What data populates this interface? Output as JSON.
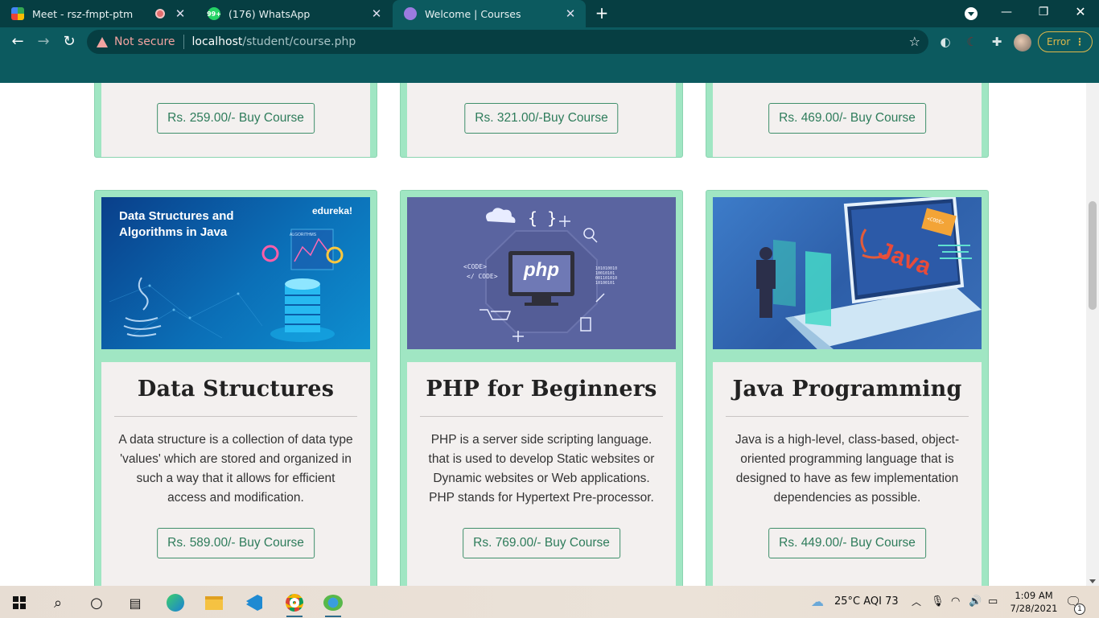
{
  "browser": {
    "tabs": [
      {
        "title": "Meet - rsz-fmpt-ptm",
        "active": false,
        "favicon": "google-meet-icon",
        "recording": true
      },
      {
        "title": "(176) WhatsApp",
        "active": false,
        "favicon": "whatsapp-icon",
        "badge": "99+"
      },
      {
        "title": "Welcome | Courses",
        "active": true,
        "favicon": "courses-site-icon"
      }
    ],
    "address_bar": {
      "security_label": "Not secure",
      "url_host": "localhost",
      "url_path": "/student/course.php"
    },
    "error_label": "Error",
    "accent": "#0c5a5f"
  },
  "courses_top_row": [
    {
      "button_label": "Rs. 259.00/- Buy Course"
    },
    {
      "button_label": "Rs. 321.00/-Buy Course"
    },
    {
      "button_label": "Rs. 469.00/- Buy Course"
    }
  ],
  "courses": [
    {
      "title": "Data Structures",
      "description": "A data structure is a collection of data type 'values' which are stored and organized in such a way that it allows for efficient access and modification.",
      "button_label": "Rs. 589.00/- Buy Course",
      "image": {
        "heading": "Data Structures and Algorithms in Java",
        "brand": "edureka!",
        "label": "ALGORITHMS"
      }
    },
    {
      "title": "PHP for Beginners",
      "description": "PHP is a server side scripting language. that is used to develop Static websites or Dynamic websites or Web applications. PHP stands for Hypertext Pre-processor.",
      "button_label": "Rs. 769.00/- Buy Course",
      "image": {
        "logo_text": "php",
        "code1": "<CODE>",
        "code2": "</ CODE>",
        "braces": "{ }",
        "binary": "101010010\n10010101\n001101010\n10100101"
      }
    },
    {
      "title": "Java Programming",
      "description": "Java is a high-level, class-based, object-oriented programming language that is designed to have as few implementation dependencies as possible.",
      "button_label": "Rs. 449.00/- Buy Course",
      "image": {
        "logo_text": "Java",
        "tag": "<CODE>"
      }
    }
  ],
  "taskbar": {
    "weather": "25°C  AQI 73",
    "time": "1:09 AM",
    "date": "7/28/2021",
    "notifications": "1"
  }
}
